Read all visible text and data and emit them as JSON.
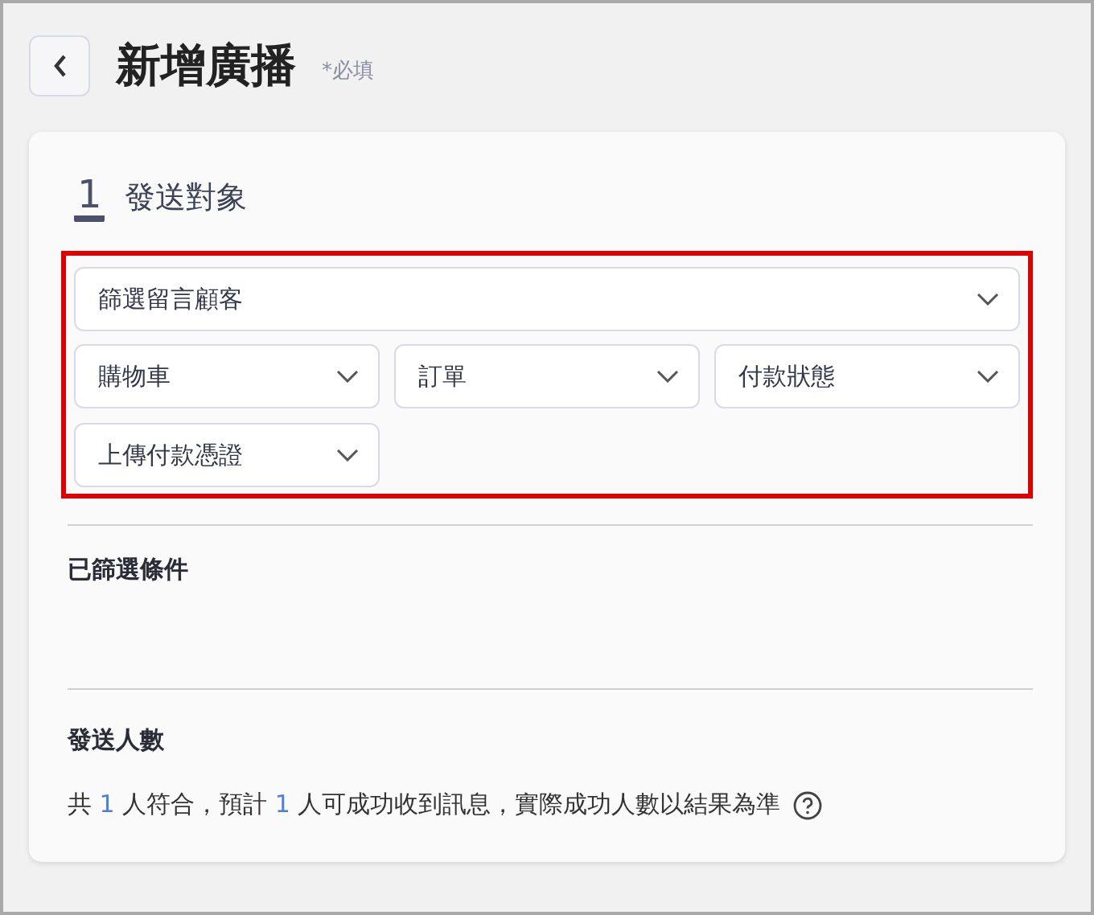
{
  "header": {
    "title": "新增廣播",
    "required_note": "*必填"
  },
  "step": {
    "number": "1",
    "title": "發送對象"
  },
  "filters": [
    {
      "label": "篩選留言顧客",
      "kind": "wide"
    },
    {
      "label": "購物車",
      "kind": "normal"
    },
    {
      "label": "訂單",
      "kind": "normal"
    },
    {
      "label": "付款狀態",
      "kind": "normal"
    },
    {
      "label": "上傳付款憑證",
      "kind": "normal"
    }
  ],
  "selected_conditions": {
    "title": "已篩選條件"
  },
  "recipients": {
    "title": "發送人數",
    "summary": [
      {
        "text": "共 ",
        "kind": "plain"
      },
      {
        "text": "1",
        "kind": "count"
      },
      {
        "text": " 人符合，預計 ",
        "kind": "plain"
      },
      {
        "text": "1",
        "kind": "count"
      },
      {
        "text": " 人可成功收到訊息，實際成功人數以結果為準",
        "kind": "plain"
      }
    ]
  }
}
